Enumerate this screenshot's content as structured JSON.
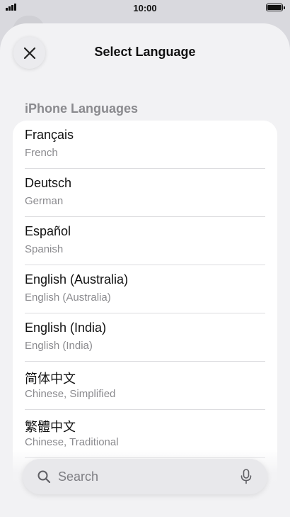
{
  "status_bar": {
    "time": "10:00"
  },
  "sheet": {
    "title": "Select Language",
    "section_header": "iPhone Languages"
  },
  "languages": [
    {
      "name": "Français",
      "subtitle": "French"
    },
    {
      "name": "Deutsch",
      "subtitle": "German"
    },
    {
      "name": "Español",
      "subtitle": "Spanish"
    },
    {
      "name": "English (Australia)",
      "subtitle": "English (Australia)"
    },
    {
      "name": "English (India)",
      "subtitle": "English (India)"
    },
    {
      "name": "简体中文",
      "subtitle": "Chinese, Simplified"
    },
    {
      "name": "繁體中文",
      "subtitle": "Chinese, Traditional"
    }
  ],
  "search": {
    "placeholder": "Search"
  },
  "icons": {
    "close": "close-icon",
    "search": "search-icon",
    "mic": "microphone-icon",
    "signal": "cellular-signal-icon",
    "battery": "battery-icon"
  }
}
